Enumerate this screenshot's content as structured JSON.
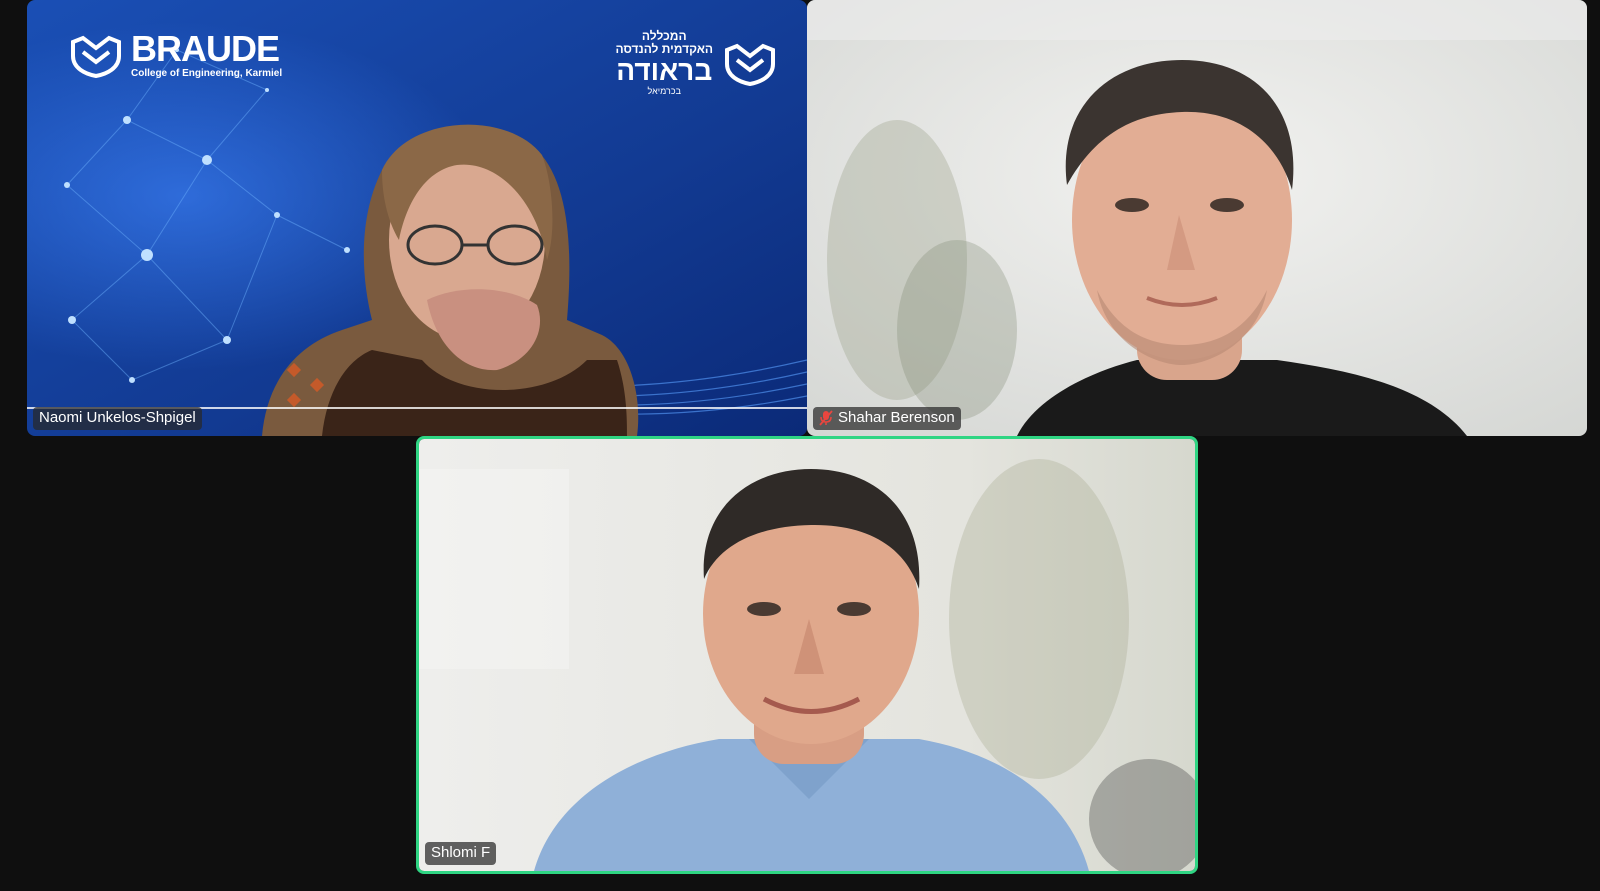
{
  "participants": [
    {
      "id": "naomi",
      "name": "Naomi Unkelos-Shpigel",
      "muted": false,
      "active_speaker": false
    },
    {
      "id": "shahar",
      "name": "Shahar Berenson",
      "muted": true,
      "active_speaker": false
    },
    {
      "id": "shlomi",
      "name": "Shlomi F",
      "muted": false,
      "active_speaker": true
    }
  ],
  "virtual_background": {
    "brand_en": "BRAUDE",
    "brand_en_sub": "College of Engineering, Karmiel",
    "brand_he_line1": "המכללה",
    "brand_he_line2": "האקדמית להנדסה",
    "brand_he_main": "בראודה",
    "brand_he_sub": "בכרמיאל"
  },
  "colors": {
    "active_speaker_border": "#2fd583",
    "muted_icon": "#e8463f",
    "background": "#0f0f0f"
  },
  "icons": {
    "muted": "microphone-muted-icon",
    "logo": "braude-crown-logo"
  }
}
